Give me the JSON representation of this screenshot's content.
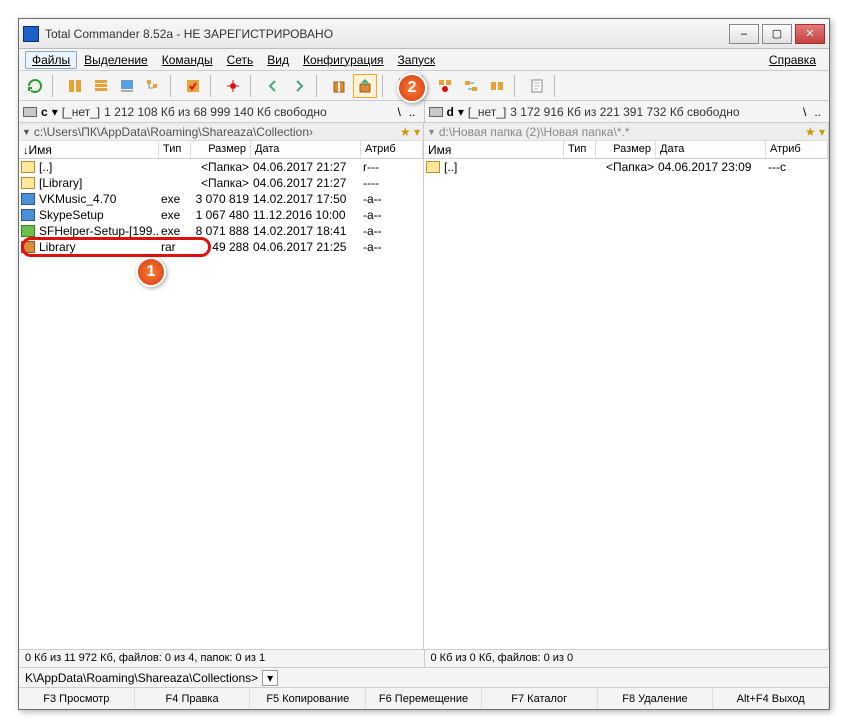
{
  "window": {
    "title": "Total Commander 8.52a - НЕ ЗАРЕГИСТРИРОВАНО"
  },
  "menu": {
    "files": "Файлы",
    "select": "Выделение",
    "cmds": "Команды",
    "net": "Сеть",
    "view": "Вид",
    "config": "Конфигурация",
    "start": "Запуск",
    "help": "Справка"
  },
  "left": {
    "drive_letter": "c",
    "drive_label": "[_нет_]",
    "drive_free": "1 212 108 Кб из 68 999 140 Кб свободно",
    "path": "c:\\Users\\ПК\\AppData\\Roaming\\Shareaza\\Collection",
    "hdr": {
      "name": "Имя",
      "type": "Тип",
      "size": "Размер",
      "date": "Дата",
      "attr": "Атриб"
    },
    "rows": [
      {
        "ic": "up",
        "name": "[..]",
        "type": "",
        "size": "<Папка>",
        "date": "04.06.2017 21:27",
        "attr": "r---"
      },
      {
        "ic": "folder",
        "name": "[Library]",
        "type": "",
        "size": "<Папка>",
        "date": "04.06.2017 21:27",
        "attr": "----"
      },
      {
        "ic": "exe",
        "name": "VKMusic_4.70",
        "type": "exe",
        "size": "3 070 819",
        "date": "14.02.2017 17:50",
        "attr": "-a--"
      },
      {
        "ic": "exe",
        "name": "SkypeSetup",
        "type": "exe",
        "size": "1 067 480",
        "date": "11.12.2016 10:00",
        "attr": "-a--"
      },
      {
        "ic": "exeg",
        "name": "SFHelper-Setup-[199..",
        "type": "exe",
        "size": "8 071 888",
        "date": "14.02.2017 18:41",
        "attr": "-a--"
      },
      {
        "ic": "rar",
        "name": "Library",
        "type": "rar",
        "size": "49 288",
        "date": "04.06.2017 21:25",
        "attr": "-a--"
      }
    ],
    "status": "0 Кб из 11 972 Кб, файлов: 0 из 4, папок: 0 из 1"
  },
  "right": {
    "drive_letter": "d",
    "drive_label": "[_нет_]",
    "drive_free": "3 172 916 Кб из 221 391 732 Кб свободно",
    "path": "d:\\Новая папка (2)\\Новая папка\\*.*",
    "hdr": {
      "name": "Имя",
      "type": "Тип",
      "size": "Размер",
      "date": "Дата",
      "attr": "Атриб"
    },
    "rows": [
      {
        "ic": "up",
        "name": "[..]",
        "type": "",
        "size": "<Папка>",
        "date": "04.06.2017 23:09",
        "attr": "---c"
      }
    ],
    "status": "0 Кб из 0 Кб, файлов: 0 из 0"
  },
  "cmdline": "K\\AppData\\Roaming\\Shareaza\\Collections>",
  "fkeys": {
    "f3": "F3 Просмотр",
    "f4": "F4 Правка",
    "f5": "F5 Копирование",
    "f6": "F6 Перемещение",
    "f7": "F7 Каталог",
    "f8": "F8 Удаление",
    "altf4": "Alt+F4 Выход"
  },
  "callouts": {
    "1": "1",
    "2": "2"
  }
}
